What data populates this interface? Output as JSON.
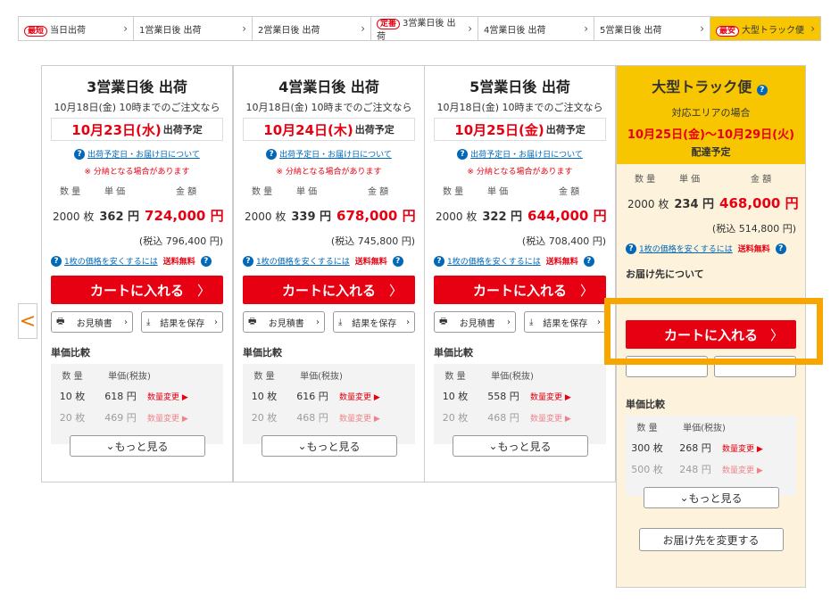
{
  "tabs": [
    {
      "badge": "最短",
      "label": "当日出荷"
    },
    {
      "badge": "",
      "label": "1営業日後 出荷"
    },
    {
      "badge": "",
      "label": "2営業日後 出荷"
    },
    {
      "badge": "定番",
      "label": "3営業日後 出荷"
    },
    {
      "badge": "",
      "label": "4営業日後 出荷"
    },
    {
      "badge": "",
      "label": "5営業日後 出荷"
    },
    {
      "badge": "最安",
      "label": "大型トラック便"
    }
  ],
  "prev_arrow": "<",
  "common": {
    "cutoff": "10月18日(金) 10時までのご注文なら",
    "ship_suffix": "出荷予定",
    "date_link": "出荷予定日・お届け日について",
    "note": "※ 分納となる場合があります",
    "qty_h": "数 量",
    "unit_h": "単 価",
    "amount_h": "金 額",
    "cheap_link": "1枚の価格を安くするには",
    "free": "送料無料",
    "cart": "カートに入れる",
    "quote": "お見積書",
    "save": "結果を保存",
    "compare": "単価比較",
    "tbl_qty": "数 量",
    "tbl_price": "単価(税抜)",
    "change": "数量変更 ▶",
    "more": "もっと見る"
  },
  "columns": [
    {
      "title": "3営業日後 出荷",
      "date": "10月23日(水)",
      "qty": "2000 枚",
      "unit": "362 円",
      "amount": "724,000 円",
      "tax": "(税込 796,400 円)",
      "rows": [
        [
          "10 枚",
          "618 円"
        ],
        [
          "20 枚",
          "469 円"
        ]
      ]
    },
    {
      "title": "4営業日後 出荷",
      "date": "10月24日(木)",
      "qty": "2000 枚",
      "unit": "339 円",
      "amount": "678,000 円",
      "tax": "(税込 745,800 円)",
      "rows": [
        [
          "10 枚",
          "616 円"
        ],
        [
          "20 枚",
          "468 円"
        ]
      ]
    },
    {
      "title": "5営業日後 出荷",
      "date": "10月25日(金)",
      "qty": "2000 枚",
      "unit": "322 円",
      "amount": "644,000 円",
      "tax": "(税込 708,400 円)",
      "rows": [
        [
          "10 枚",
          "558 円"
        ],
        [
          "20 枚",
          "468 円"
        ]
      ]
    }
  ],
  "truck": {
    "title": "大型トラック便",
    "area": "対応エリアの場合",
    "range": "10月25日(金)～10月29日(火)",
    "delivery": "配達予定",
    "qty": "2000 枚",
    "unit": "234 円",
    "amount": "468,000 円",
    "tax": "(税込 514,800 円)",
    "dest": "お届け先について",
    "rows": [
      [
        "300 枚",
        "268 円"
      ],
      [
        "500 枚",
        "248 円"
      ]
    ],
    "change_dest": "お届け先を変更する"
  }
}
